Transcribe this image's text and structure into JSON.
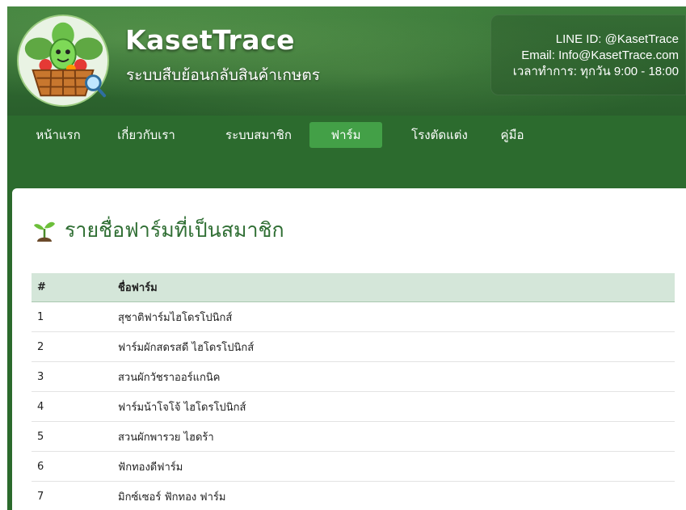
{
  "header": {
    "brand_title": "KasetTrace",
    "brand_subtitle": "ระบบสืบย้อนกลับสินค้าเกษตร",
    "contact": {
      "line_id": "LINE ID: @KasetTrace",
      "email": "Email: Info@KasetTrace.com",
      "hours": "เวลาทำการ: ทุกวัน 9:00 - 18:00"
    }
  },
  "nav": {
    "items": [
      {
        "label": "หน้าแรก"
      },
      {
        "label": "เกี่ยวกับเรา"
      },
      {
        "label": "ระบบสมาชิก"
      },
      {
        "label": "ฟาร์ม"
      },
      {
        "label": "โรงตัดแต่ง"
      },
      {
        "label": "คู่มือ"
      }
    ],
    "active": "ฟาร์ม"
  },
  "main": {
    "title": "รายชื่อฟาร์มที่เป็นสมาชิก",
    "icon": "sprout-icon",
    "table": {
      "headers": [
        "#",
        "ชื่อฟาร์ม"
      ],
      "rows": [
        [
          "1",
          "สุชาติฟาร์มไฮโดรโปนิกส์"
        ],
        [
          "2",
          "ฟาร์มผักสดรสดี ไฮโดรโปนิกส์"
        ],
        [
          "3",
          "สวนผักวัชราออร์แกนิค"
        ],
        [
          "4",
          "ฟาร์มน้าโจโจ้ ไฮโดรโปนิกส์"
        ],
        [
          "5",
          "สวนผักพารวย ไฮดร้า"
        ],
        [
          "6",
          "ฟักทองดีฟาร์ม"
        ],
        [
          "7",
          "มิกซ์เซอร์ ฟักทอง ฟาร์ม"
        ]
      ]
    }
  },
  "colors": {
    "header_green": "#2f6a31",
    "nav_active": "#43a047",
    "title_green": "#2f6e33",
    "table_header_bg": "#d4e6d9"
  }
}
